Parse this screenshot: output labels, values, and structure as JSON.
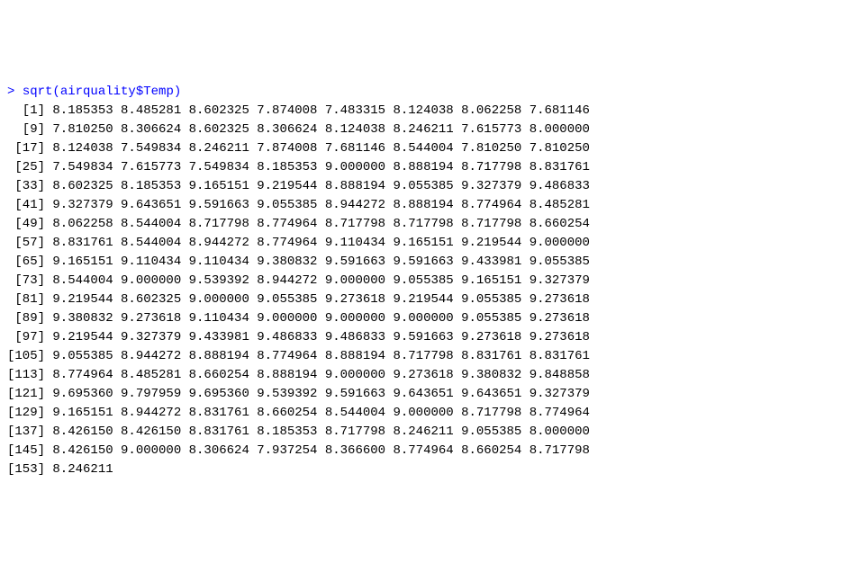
{
  "prompt": ">",
  "command": "sqrt(airquality$Temp)",
  "rows": [
    {
      "idx": "  [1]",
      "vals": [
        "8.185353",
        "8.485281",
        "8.602325",
        "7.874008",
        "7.483315",
        "8.124038",
        "8.062258",
        "7.681146"
      ]
    },
    {
      "idx": "  [9]",
      "vals": [
        "7.810250",
        "8.306624",
        "8.602325",
        "8.306624",
        "8.124038",
        "8.246211",
        "7.615773",
        "8.000000"
      ]
    },
    {
      "idx": " [17]",
      "vals": [
        "8.124038",
        "7.549834",
        "8.246211",
        "7.874008",
        "7.681146",
        "8.544004",
        "7.810250",
        "7.810250"
      ]
    },
    {
      "idx": " [25]",
      "vals": [
        "7.549834",
        "7.615773",
        "7.549834",
        "8.185353",
        "9.000000",
        "8.888194",
        "8.717798",
        "8.831761"
      ]
    },
    {
      "idx": " [33]",
      "vals": [
        "8.602325",
        "8.185353",
        "9.165151",
        "9.219544",
        "8.888194",
        "9.055385",
        "9.327379",
        "9.486833"
      ]
    },
    {
      "idx": " [41]",
      "vals": [
        "9.327379",
        "9.643651",
        "9.591663",
        "9.055385",
        "8.944272",
        "8.888194",
        "8.774964",
        "8.485281"
      ]
    },
    {
      "idx": " [49]",
      "vals": [
        "8.062258",
        "8.544004",
        "8.717798",
        "8.774964",
        "8.717798",
        "8.717798",
        "8.717798",
        "8.660254"
      ]
    },
    {
      "idx": " [57]",
      "vals": [
        "8.831761",
        "8.544004",
        "8.944272",
        "8.774964",
        "9.110434",
        "9.165151",
        "9.219544",
        "9.000000"
      ]
    },
    {
      "idx": " [65]",
      "vals": [
        "9.165151",
        "9.110434",
        "9.110434",
        "9.380832",
        "9.591663",
        "9.591663",
        "9.433981",
        "9.055385"
      ]
    },
    {
      "idx": " [73]",
      "vals": [
        "8.544004",
        "9.000000",
        "9.539392",
        "8.944272",
        "9.000000",
        "9.055385",
        "9.165151",
        "9.327379"
      ]
    },
    {
      "idx": " [81]",
      "vals": [
        "9.219544",
        "8.602325",
        "9.000000",
        "9.055385",
        "9.273618",
        "9.219544",
        "9.055385",
        "9.273618"
      ]
    },
    {
      "idx": " [89]",
      "vals": [
        "9.380832",
        "9.273618",
        "9.110434",
        "9.000000",
        "9.000000",
        "9.000000",
        "9.055385",
        "9.273618"
      ]
    },
    {
      "idx": " [97]",
      "vals": [
        "9.219544",
        "9.327379",
        "9.433981",
        "9.486833",
        "9.486833",
        "9.591663",
        "9.273618",
        "9.273618"
      ]
    },
    {
      "idx": "[105]",
      "vals": [
        "9.055385",
        "8.944272",
        "8.888194",
        "8.774964",
        "8.888194",
        "8.717798",
        "8.831761",
        "8.831761"
      ]
    },
    {
      "idx": "[113]",
      "vals": [
        "8.774964",
        "8.485281",
        "8.660254",
        "8.888194",
        "9.000000",
        "9.273618",
        "9.380832",
        "9.848858"
      ]
    },
    {
      "idx": "[121]",
      "vals": [
        "9.695360",
        "9.797959",
        "9.695360",
        "9.539392",
        "9.591663",
        "9.643651",
        "9.643651",
        "9.327379"
      ]
    },
    {
      "idx": "[129]",
      "vals": [
        "9.165151",
        "8.944272",
        "8.831761",
        "8.660254",
        "8.544004",
        "9.000000",
        "8.717798",
        "8.774964"
      ]
    },
    {
      "idx": "[137]",
      "vals": [
        "8.426150",
        "8.426150",
        "8.831761",
        "8.185353",
        "8.717798",
        "8.246211",
        "9.055385",
        "8.000000"
      ]
    },
    {
      "idx": "[145]",
      "vals": [
        "8.426150",
        "9.000000",
        "8.306624",
        "7.937254",
        "8.366600",
        "8.774964",
        "8.660254",
        "8.717798"
      ]
    },
    {
      "idx": "[153]",
      "vals": [
        "8.246211"
      ]
    }
  ]
}
